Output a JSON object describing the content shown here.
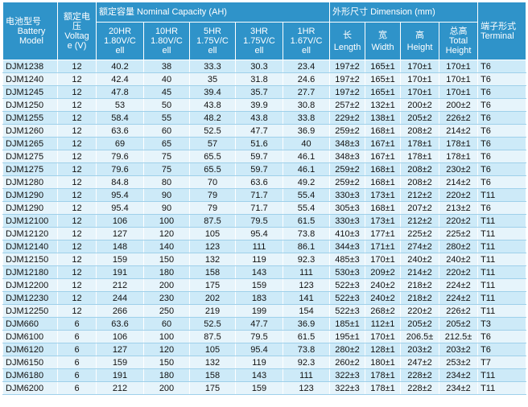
{
  "headers": {
    "model": [
      "电池型号",
      "Battery",
      "Model"
    ],
    "voltage": [
      "额定电",
      "压",
      "Voltag",
      "e (V)"
    ],
    "capacity_group": "额定容量 Nominal Capacity (AH)",
    "capacity_cols": [
      [
        "20HR",
        "1.80V/C",
        "ell"
      ],
      [
        "10HR",
        "1.80V/C",
        "ell"
      ],
      [
        "5HR",
        "1.75V/C",
        "ell"
      ],
      [
        "3HR",
        "1.75V/C",
        "ell"
      ],
      [
        "1HR",
        "1.67V/C",
        "ell"
      ]
    ],
    "dimension_group": "外形尺寸 Dimension (mm)",
    "dimension_cols": [
      [
        "长",
        "Length"
      ],
      [
        "宽",
        "Width"
      ],
      [
        "高",
        "Height"
      ],
      [
        "总高",
        "Total",
        "Height"
      ]
    ],
    "terminal": [
      "端子形式",
      "Terminal"
    ]
  },
  "rows": [
    [
      "DJM1238",
      "12",
      "40.2",
      "38",
      "33.3",
      "30.3",
      "23.4",
      "197±2",
      "165±1",
      "170±1",
      "170±1",
      "T6"
    ],
    [
      "DJM1240",
      "12",
      "42.4",
      "40",
      "35",
      "31.8",
      "24.6",
      "197±2",
      "165±1",
      "170±1",
      "170±1",
      "T6"
    ],
    [
      "DJM1245",
      "12",
      "47.8",
      "45",
      "39.4",
      "35.7",
      "27.7",
      "197±2",
      "165±1",
      "170±1",
      "170±1",
      "T6"
    ],
    [
      "DJM1250",
      "12",
      "53",
      "50",
      "43.8",
      "39.9",
      "30.8",
      "257±2",
      "132±1",
      "200±2",
      "200±2",
      "T6"
    ],
    [
      "DJM1255",
      "12",
      "58.4",
      "55",
      "48.2",
      "43.8",
      "33.8",
      "229±2",
      "138±1",
      "205±2",
      "226±2",
      "T6"
    ],
    [
      "DJM1260",
      "12",
      "63.6",
      "60",
      "52.5",
      "47.7",
      "36.9",
      "259±2",
      "168±1",
      "208±2",
      "214±2",
      "T6"
    ],
    [
      "DJM1265",
      "12",
      "69",
      "65",
      "57",
      "51.6",
      "40",
      "348±3",
      "167±1",
      "178±1",
      "178±1",
      "T6"
    ],
    [
      "DJM1275",
      "12",
      "79.6",
      "75",
      "65.5",
      "59.7",
      "46.1",
      "348±3",
      "167±1",
      "178±1",
      "178±1",
      "T6"
    ],
    [
      "DJM1275",
      "12",
      "79.6",
      "75",
      "65.5",
      "59.7",
      "46.1",
      "259±2",
      "168±1",
      "208±2",
      "230±2",
      "T6"
    ],
    [
      "DJM1280",
      "12",
      "84.8",
      "80",
      "70",
      "63.6",
      "49.2",
      "259±2",
      "168±1",
      "208±2",
      "214±2",
      "T6"
    ],
    [
      "DJM1290",
      "12",
      "95.4",
      "90",
      "79",
      "71.7",
      "55.4",
      "330±3",
      "173±1",
      "212±2",
      "220±2",
      "T11"
    ],
    [
      "DJM1290",
      "12",
      "95.4",
      "90",
      "79",
      "71.7",
      "55.4",
      "305±3",
      "168±1",
      "207±2",
      "213±2",
      "T6"
    ],
    [
      "DJM12100",
      "12",
      "106",
      "100",
      "87.5",
      "79.5",
      "61.5",
      "330±3",
      "173±1",
      "212±2",
      "220±2",
      "T11"
    ],
    [
      "DJM12120",
      "12",
      "127",
      "120",
      "105",
      "95.4",
      "73.8",
      "410±3",
      "177±1",
      "225±2",
      "225±2",
      "T11"
    ],
    [
      "DJM12140",
      "12",
      "148",
      "140",
      "123",
      "111",
      "86.1",
      "344±3",
      "171±1",
      "274±2",
      "280±2",
      "T11"
    ],
    [
      "DJM12150",
      "12",
      "159",
      "150",
      "132",
      "119",
      "92.3",
      "485±3",
      "170±1",
      "240±2",
      "240±2",
      "T11"
    ],
    [
      "DJM12180",
      "12",
      "191",
      "180",
      "158",
      "143",
      "111",
      "530±3",
      "209±2",
      "214±2",
      "220±2",
      "T11"
    ],
    [
      "DJM12200",
      "12",
      "212",
      "200",
      "175",
      "159",
      "123",
      "522±3",
      "240±2",
      "218±2",
      "224±2",
      "T11"
    ],
    [
      "DJM12230",
      "12",
      "244",
      "230",
      "202",
      "183",
      "141",
      "522±3",
      "240±2",
      "218±2",
      "224±2",
      "T11"
    ],
    [
      "DJM12250",
      "12",
      "266",
      "250",
      "219",
      "199",
      "154",
      "522±3",
      "268±2",
      "220±2",
      "226±2",
      "T11"
    ],
    [
      "DJM660",
      "6",
      "63.6",
      "60",
      "52.5",
      "47.7",
      "36.9",
      "185±1",
      "112±1",
      "205±2",
      "205±2",
      "T3"
    ],
    [
      "DJM6100",
      "6",
      "106",
      "100",
      "87.5",
      "79.5",
      "61.5",
      "195±1",
      "170±1",
      "206.5±",
      "212.5±",
      "T6"
    ],
    [
      "DJM6120",
      "6",
      "127",
      "120",
      "105",
      "95.4",
      "73.8",
      "280±2",
      "128±1",
      "203±2",
      "203±2",
      "T6"
    ],
    [
      "DJM6150",
      "6",
      "159",
      "150",
      "132",
      "119",
      "92.3",
      "260±2",
      "180±1",
      "247±2",
      "253±2",
      "T7"
    ],
    [
      "DJM6180",
      "6",
      "191",
      "180",
      "158",
      "143",
      "111",
      "322±3",
      "178±1",
      "228±2",
      "234±2",
      "T11"
    ],
    [
      "DJM6200",
      "6",
      "212",
      "200",
      "175",
      "159",
      "123",
      "322±3",
      "178±1",
      "228±2",
      "234±2",
      "T11"
    ]
  ]
}
